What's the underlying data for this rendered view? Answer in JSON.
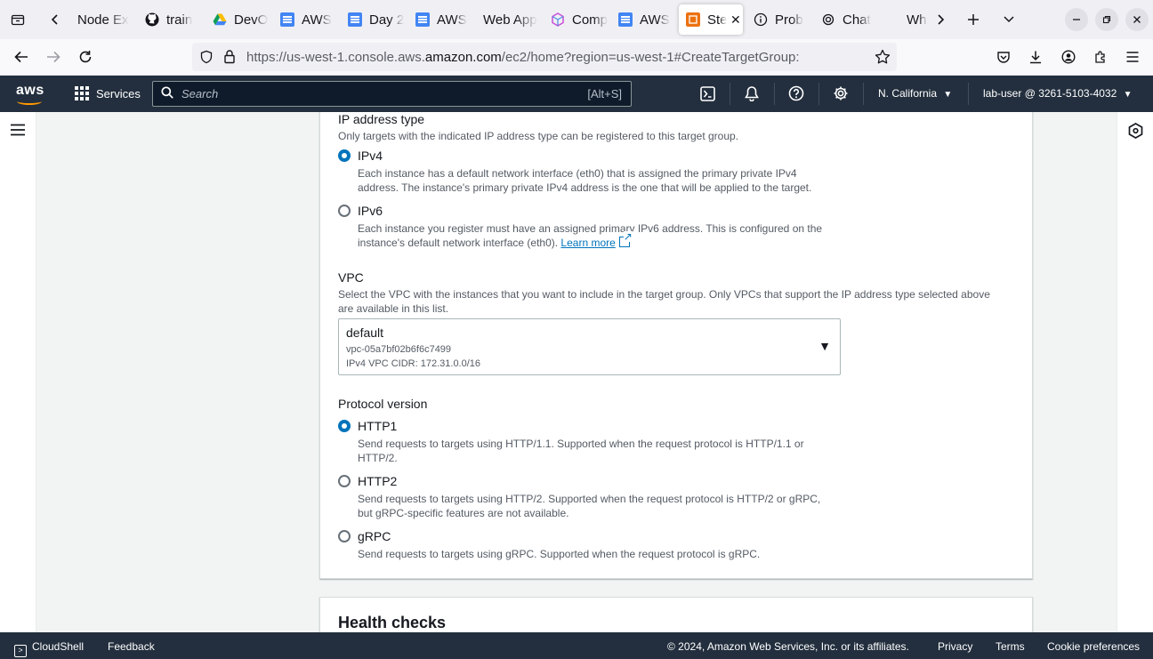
{
  "browser": {
    "tabs": [
      {
        "label": "Node Ex",
        "icon": "none"
      },
      {
        "label": "train",
        "icon": "github-icon"
      },
      {
        "label": "DevO",
        "icon": "google-drive-icon"
      },
      {
        "label": "AWS",
        "icon": "google-docs-icon"
      },
      {
        "label": "Day 2",
        "icon": "google-docs-icon"
      },
      {
        "label": "AWS",
        "icon": "google-docs-icon"
      },
      {
        "label": "Web App",
        "icon": "none"
      },
      {
        "label": "Comp",
        "icon": "cube-icon"
      },
      {
        "label": "AWS",
        "icon": "google-docs-icon"
      },
      {
        "label": "Ste",
        "icon": "aws-ec2-icon",
        "active": true
      },
      {
        "label": "Prob",
        "icon": "info-icon"
      },
      {
        "label": "Chat",
        "icon": "openai-icon"
      },
      {
        "label": "Wh",
        "icon": "none"
      }
    ],
    "url_prefix": "https://us-west-1.console.aws.",
    "url_domain": "amazon.com",
    "url_suffix": "/ec2/home?region=us-west-1#CreateTargetGroup:"
  },
  "aws_bar": {
    "logo_text": "aws",
    "services_label": "Services",
    "search_placeholder": "Search",
    "search_shortcut": "[Alt+S]",
    "region": "N. California",
    "account": "lab-user @ 3261-5103-4032"
  },
  "ip_address_type": {
    "label": "IP address type",
    "description": "Only targets with the indicated IP address type can be registered to this target group.",
    "options": [
      {
        "label": "IPv4",
        "checked": true,
        "desc_line1": "Each instance has a default network interface (eth0) that is assigned the primary private IPv4",
        "desc_line2": "address. The instance's primary private IPv4 address is the one that will be applied to the target."
      },
      {
        "label": "IPv6",
        "checked": false,
        "desc_line1": "Each instance you register must have an assigned primary IPv6 address. This is configured on the",
        "desc_line2": "instance's default network interface (eth0).",
        "link": "Learn more"
      }
    ]
  },
  "vpc": {
    "label": "VPC",
    "desc_line1": "Select the VPC with the instances that you want to include in the target group. Only VPCs that support the IP address type selected above",
    "desc_line2": "are available in this list.",
    "selected_name": "default",
    "selected_id": "vpc-05a7bf02b6f6c7499",
    "selected_cidr": "IPv4 VPC CIDR: 172.31.0.0/16"
  },
  "protocol_version": {
    "label": "Protocol version",
    "options": [
      {
        "label": "HTTP1",
        "checked": true,
        "desc_line1": "Send requests to targets using HTTP/1.1. Supported when the request protocol is HTTP/1.1 or",
        "desc_line2": "HTTP/2."
      },
      {
        "label": "HTTP2",
        "checked": false,
        "desc_line1": "Send requests to targets using HTTP/2. Supported when the request protocol is HTTP/2 or gRPC,",
        "desc_line2": "but gRPC-specific features are not available."
      },
      {
        "label": "gRPC",
        "checked": false,
        "desc_line1": "Send requests to targets using gRPC. Supported when the request protocol is gRPC."
      }
    ]
  },
  "health_checks": {
    "title": "Health checks"
  },
  "footer": {
    "cloudshell": "CloudShell",
    "feedback": "Feedback",
    "copyright": "© 2024, Amazon Web Services, Inc. or its affiliates.",
    "privacy": "Privacy",
    "terms": "Terms",
    "cookie": "Cookie preferences"
  },
  "colors": {
    "aws_navy": "#232f3e",
    "aws_orange": "#ff9900",
    "link_blue": "#0073bb",
    "radio_checked": "#0073bb"
  }
}
